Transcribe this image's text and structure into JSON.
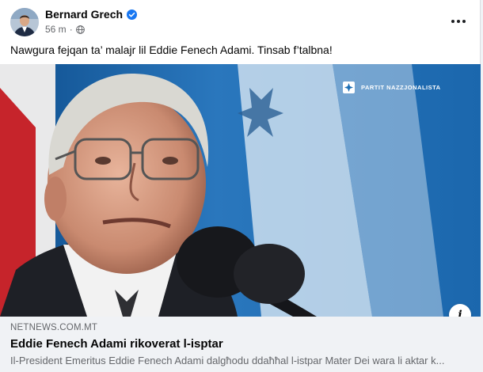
{
  "post": {
    "author": "Bernard Grech",
    "time": "56 m",
    "separator": "·",
    "text": "Nawgura fejqan ta’ malajr lil Eddie Fenech Adami. Tinsab f’talbna!"
  },
  "image": {
    "watermark": "PARTIT NAZZJONALISTA"
  },
  "link_preview": {
    "domain": "NETNEWS.COM.MT",
    "title": "Eddie Fenech Adami rikoverat l-isptar",
    "description": "Il-President Emeritus Eddie Fenech Adami dalgħodu ddaħħal l-istpar Mater Dei wara li aktar k..."
  },
  "icons": {
    "verified": "verified-badge-icon",
    "audience": "globe-icon",
    "menu": "more-options-icon",
    "info": "info-icon"
  },
  "colors": {
    "accent": "#1877f2",
    "secondary_text": "#65676b",
    "preview_bg": "#f0f2f5"
  }
}
